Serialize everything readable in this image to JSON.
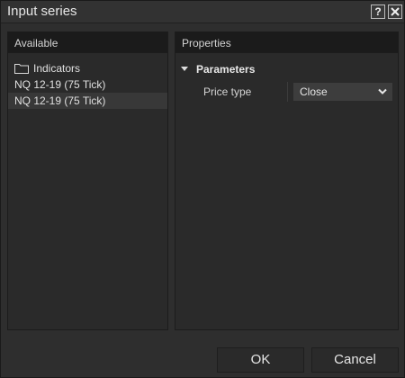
{
  "window": {
    "title": "Input series",
    "help_label": "?"
  },
  "available": {
    "header": "Available",
    "items": [
      {
        "label": "Indicators",
        "icon": "folder-icon"
      },
      {
        "label": "NQ 12-19 (75 Tick)"
      },
      {
        "label": "NQ 12-19 (75 Tick)",
        "selected": true
      }
    ]
  },
  "properties": {
    "header": "Properties",
    "group": "Parameters",
    "rows": [
      {
        "label": "Price type",
        "value": "Close"
      }
    ]
  },
  "footer": {
    "ok_label": "OK",
    "cancel_label": "Cancel"
  }
}
